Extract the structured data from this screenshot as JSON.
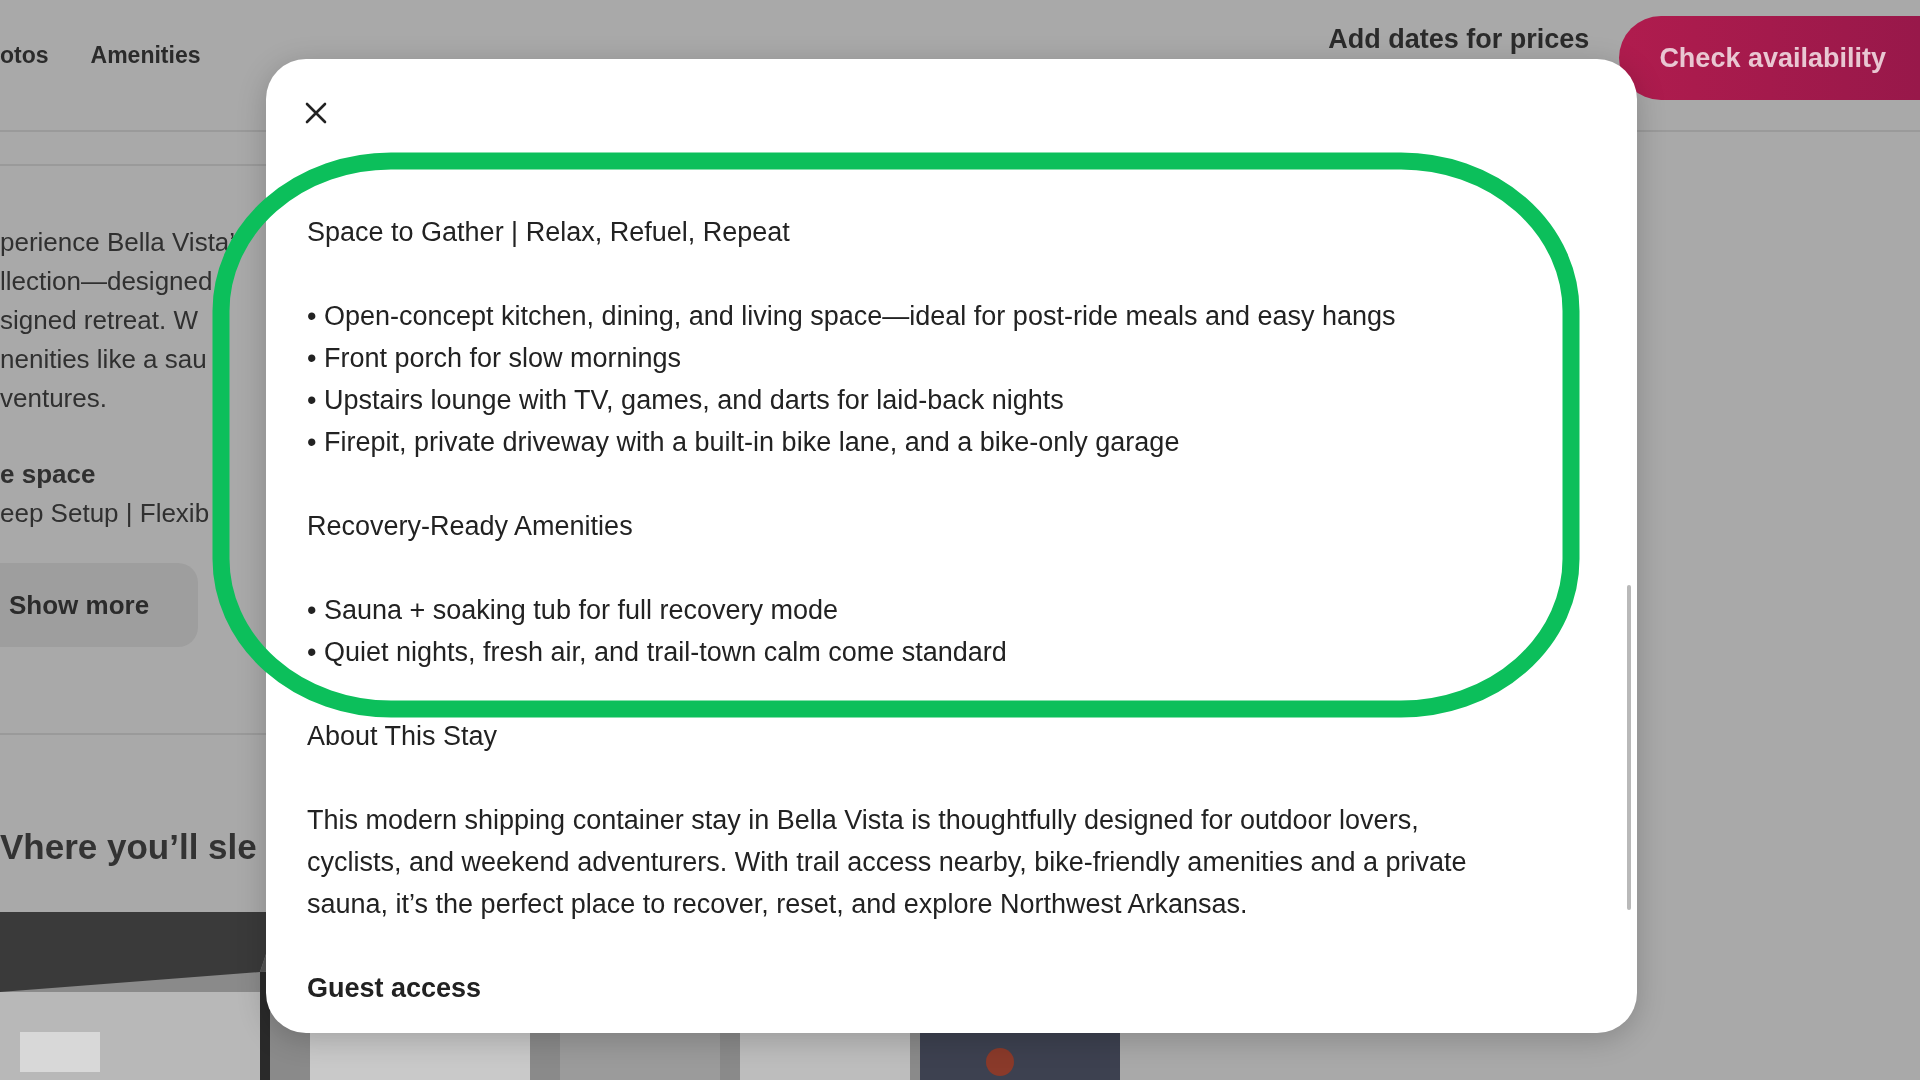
{
  "nav": {
    "tabs": [
      {
        "label": "otos"
      },
      {
        "label": "Amenities"
      }
    ],
    "price_note": "Add dates for prices",
    "cta": "Check availability"
  },
  "listing": {
    "description_lines": [
      "perience Bella Vista’",
      "llection—designed",
      "signed retreat. W",
      "nenities like a sau",
      "ventures."
    ],
    "section_title": "e space",
    "section_lines": [
      "eep Setup | Flexib"
    ],
    "show_more": "Show more",
    "sleep_heading": "Vhere you’ll sle",
    "photos": {
      "kind": "picture"
    }
  },
  "modal": {
    "sections": [
      {
        "heading": "Space to Gather | Relax, Refuel, Repeat",
        "strong": false,
        "kind": "bullets",
        "items": [
          "• Open-concept kitchen, dining, and living space—ideal for post-ride meals and easy hangs",
          "• Front porch for slow mornings",
          "• Upstairs lounge with TV, games, and darts for laid-back nights",
          "• Firepit, private driveway with a built-in bike lane, and a bike-only garage"
        ]
      },
      {
        "heading": "Recovery-Ready Amenities",
        "strong": false,
        "kind": "bullets",
        "items": [
          "• Sauna + soaking tub for full recovery mode",
          "• Quiet nights, fresh air, and trail-town calm come standard"
        ]
      },
      {
        "heading": "About This Stay",
        "strong": false,
        "kind": "paragraph",
        "text": "This modern shipping container stay in Bella Vista is thoughtfully designed for outdoor lovers, cyclists, and weekend adventurers. With trail access nearby, bike-friendly amenities and a private sauna, it’s the perfect place to recover, reset, and explore Northwest Arkansas."
      },
      {
        "heading": "Guest access",
        "strong": true,
        "kind": "heading_only"
      }
    ]
  }
}
